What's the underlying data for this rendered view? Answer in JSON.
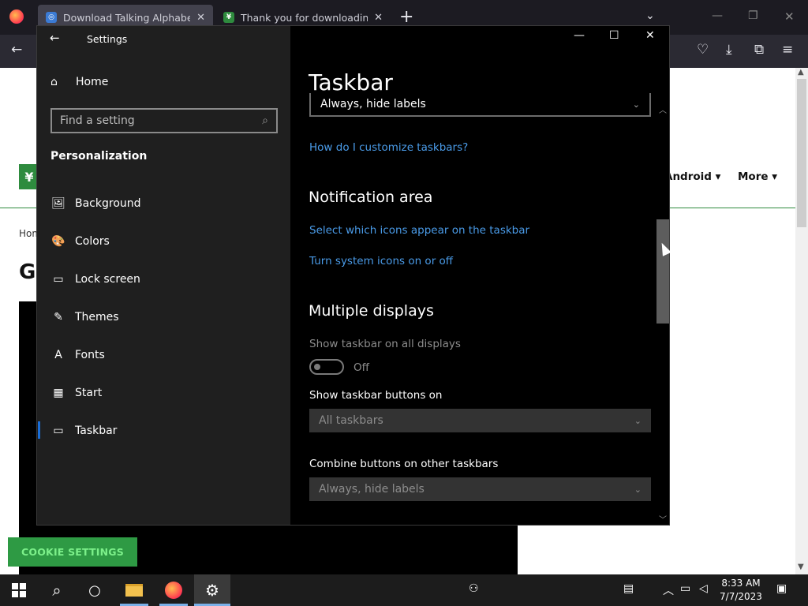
{
  "browser": {
    "tabs": [
      {
        "title": "Download Talking Alphabet by",
        "favicon_color": "#3b7bd4"
      },
      {
        "title": "Thank you for downloading Mi",
        "favicon_color": "#2e8b3e"
      }
    ],
    "new_tab_label": "+",
    "icons": [
      "firefox-logo",
      "back-arrow",
      "pocket-icon",
      "download-icon",
      "extensions-icon",
      "menu-icon"
    ]
  },
  "webpage": {
    "nav_items": [
      "Android",
      "More"
    ],
    "breadcrumb": "Hom",
    "headline": "G",
    "cookie_button": "COOKIE SETTINGS"
  },
  "settings": {
    "window_title": "Settings",
    "home_label": "Home",
    "search_placeholder": "Find a setting",
    "section_label": "Personalization",
    "sidebar_items": [
      {
        "label": "Background",
        "icon": "image-icon",
        "glyph": "🖼"
      },
      {
        "label": "Colors",
        "icon": "palette-icon",
        "glyph": "🎨"
      },
      {
        "label": "Lock screen",
        "icon": "lock-screen-icon",
        "glyph": "▭"
      },
      {
        "label": "Themes",
        "icon": "brush-icon",
        "glyph": "✎"
      },
      {
        "label": "Fonts",
        "icon": "font-icon",
        "glyph": "A"
      },
      {
        "label": "Start",
        "icon": "start-icon",
        "glyph": "▦"
      },
      {
        "label": "Taskbar",
        "icon": "taskbar-icon",
        "glyph": "▭"
      }
    ],
    "selected_item": "Taskbar",
    "content": {
      "title": "Taskbar",
      "top_dropdown_value": "Always, hide labels",
      "customize_link": "How do I customize taskbars?",
      "notification_heading": "Notification area",
      "notification_link_1": "Select which icons appear on the taskbar",
      "notification_link_2": "Turn system icons on or off",
      "multiple_heading": "Multiple displays",
      "show_all_label": "Show taskbar on all displays",
      "toggle_state": "Off",
      "buttons_on_label": "Show taskbar buttons on",
      "buttons_on_value": "All taskbars",
      "combine_label": "Combine buttons on other taskbars",
      "combine_value": "Always, hide labels"
    },
    "accent_color": "#1a6ed8",
    "link_color": "#4a9be8"
  },
  "taskbar": {
    "time": "8:33 AM",
    "date": "7/7/2023"
  }
}
